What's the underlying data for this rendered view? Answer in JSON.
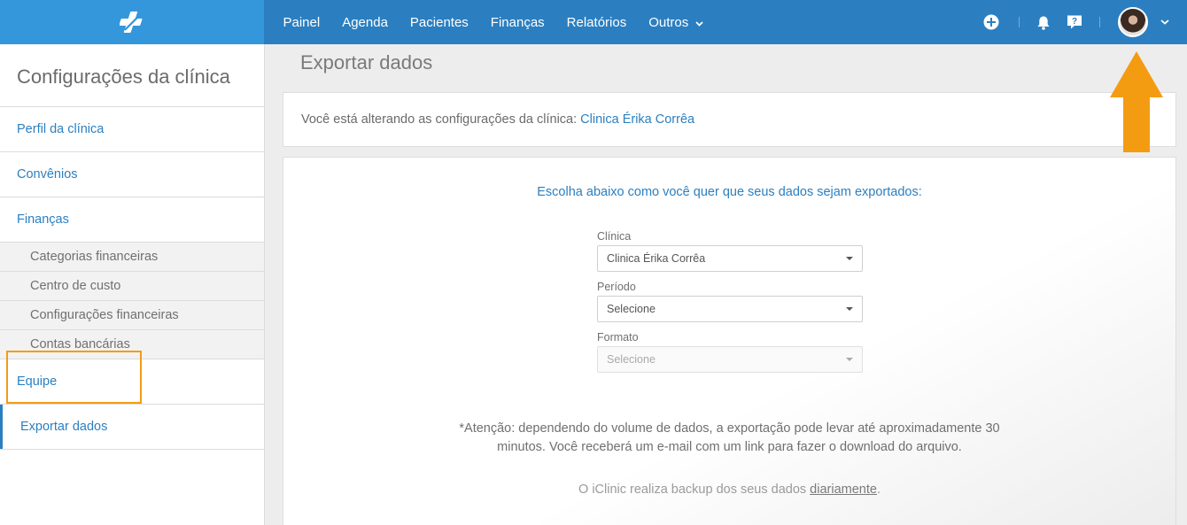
{
  "topbar": {
    "logo_icon": "iclinic-cross-logo-icon",
    "nav": [
      {
        "label": "Painel"
      },
      {
        "label": "Agenda"
      },
      {
        "label": "Pacientes"
      },
      {
        "label": "Finanças"
      },
      {
        "label": "Relatórios"
      },
      {
        "label": "Outros"
      }
    ],
    "actions": [
      "plus-circle-icon",
      "bell-icon",
      "help-icon",
      "avatar",
      "chevron-down-icon"
    ],
    "brand_color": "#2b7fc0"
  },
  "sidebar": {
    "title": "Configurações da clínica",
    "items": [
      {
        "label": "Perfil da clínica"
      },
      {
        "label": "Convênios"
      },
      {
        "label": "Finanças"
      },
      {
        "label": "Categorias financeiras"
      },
      {
        "label": "Centro de custo"
      },
      {
        "label": "Configurações financeiras"
      },
      {
        "label": "Contas bancárias"
      },
      {
        "label": "Equipe"
      },
      {
        "label": "Exportar dados"
      }
    ],
    "active_item": "Exportar dados"
  },
  "main": {
    "page_title": "Exportar dados",
    "clinic_notice_label": "Você está alterando as configurações da clínica:",
    "clinic_name": "Clinica Érika Corrêa",
    "intro": "Escolha abaixo como você quer que seus dados sejam exportados:",
    "form": {
      "clinica_label": "Clínica",
      "clinica_value": "Clinica Érika Corrêa",
      "periodo_label": "Período",
      "periodo_value": "Selecione",
      "formato_label": "Formato",
      "formato_value": "Selecione"
    },
    "note_line1": "*Atenção: dependendo do volume de dados, a exportação pode levar até aproximadamente 30",
    "note_line2": "minutos. Você receberá um e-mail com um link para fazer o download do arquivo.",
    "backup_prefix": "O iClinic realiza backup dos seus dados ",
    "backup_link": "diariamente",
    "backup_suffix": "."
  },
  "annotations": {
    "highlight_color": "#f39c12",
    "arrow_color": "#f39c12"
  }
}
